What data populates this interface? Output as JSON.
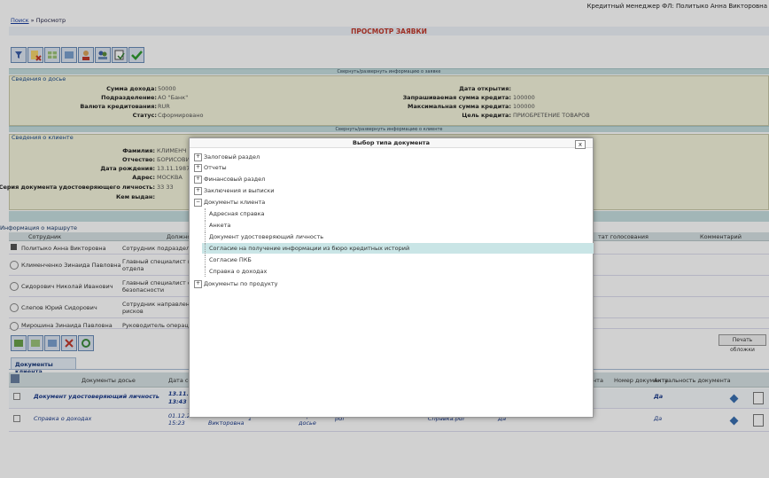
{
  "header": {
    "user": "Кредитный менеджер ФЛ: Политыко Анна Викторовна"
  },
  "breadcrumb": {
    "link": "Поиск",
    "sep": "»",
    "current": "Просмотр"
  },
  "page_title": "ПРОСМОТР ЗАЯВКИ",
  "toggle_request": "Свернуть/развернуть информацию о заявке",
  "toggle_client": "Свернуть/развернуть информацию о клиенте",
  "dossier": {
    "title": "Сведения о досье",
    "left": [
      {
        "label": "Сумма дохода:",
        "value": "50000"
      },
      {
        "label": "Подразделение:",
        "value": "АО \"Банк\""
      },
      {
        "label": "Валюта кредитования:",
        "value": "RUR"
      },
      {
        "label": "Статус:",
        "value": "Сформировано"
      }
    ],
    "right": [
      {
        "label": "Дата открытия:",
        "value": ""
      },
      {
        "label": "Запрашиваемая сумма кредита:",
        "value": "100000"
      },
      {
        "label": "Максимальная сумма кредита:",
        "value": "100000"
      },
      {
        "label": "Цель кредита:",
        "value": "ПРИОБРЕТЕНИЕ ТОВАРОВ"
      }
    ]
  },
  "client": {
    "title": "Сведения о клиенте",
    "fields": [
      {
        "label": "Фамилия:",
        "value": "КЛИМЕНЧ"
      },
      {
        "label": "Отчество:",
        "value": "БОРИСОВИ"
      },
      {
        "label": "Дата рождения:",
        "value": "13.11.1987"
      },
      {
        "label": "Адрес:",
        "value": "МОСКВА"
      },
      {
        "label": "Серия документа удостоверяющего личность:",
        "value": "33 33"
      },
      {
        "label": "Кем выдан:",
        "value": ""
      }
    ]
  },
  "route": {
    "title": "Информация о маршруте",
    "headers": [
      "Сотрудник",
      "Должность",
      "тат голосования",
      "Комментарий"
    ],
    "rows": [
      {
        "name": "Политыко Анна Викторовна",
        "pos": "Сотрудник подразделения"
      },
      {
        "name": "Клименченко Зинаида Павловна",
        "pos": "Главный специалист юрид",
        "pos2": "отдела"
      },
      {
        "name": "Сидорович Николай Иванович",
        "pos": "Главный специалист служ",
        "pos2": "безопасности"
      },
      {
        "name": "Слепов Юрий Сидорович",
        "pos": "Сотрудник направления кр",
        "pos2": "рисков"
      },
      {
        "name": "Мирошина Зинаида Павловна",
        "pos": "Руководитель операционн"
      }
    ]
  },
  "print_button": "Печать обложки",
  "docs_tab": "Документы клиента",
  "docs": {
    "headers": [
      "Документы досье",
      "Дата со",
      "мента",
      "Номер документа",
      "Актуальность документа"
    ],
    "rows": [
      {
        "name": "Документ удостоверяющий личность",
        "date": "13.11.2",
        "time": "13:43",
        "actual": "Да"
      },
      {
        "name": "Справка о доходах",
        "date": "01.12.2017",
        "time": "15:23",
        "author": "Политыко Анна",
        "author2": "Викторовна",
        "num": "1",
        "type": "Первичное",
        "type2": "досье",
        "ext": "pdf",
        "file": "Справка.pdf",
        "flag": "Да",
        "actual": "Да"
      }
    ]
  },
  "modal": {
    "title": "Выбор типа документа",
    "close": "x",
    "items": [
      {
        "label": "Залоговый раздел",
        "toggle": "+"
      },
      {
        "label": "Отчеты",
        "toggle": "+"
      },
      {
        "label": "Финансовый раздел",
        "toggle": "+"
      },
      {
        "label": "Заключения и выписки",
        "toggle": "+"
      },
      {
        "label": "Документы клиента",
        "toggle": "−"
      }
    ],
    "children": [
      "Адресная справка",
      "Анкета",
      "Документ удостоверяющий личность",
      "Согласие на получение информации из бюро кредитных историй",
      "Согласие ПКБ",
      "Справка о доходах"
    ],
    "last": {
      "label": "Документы по продукту",
      "toggle": "+"
    }
  }
}
